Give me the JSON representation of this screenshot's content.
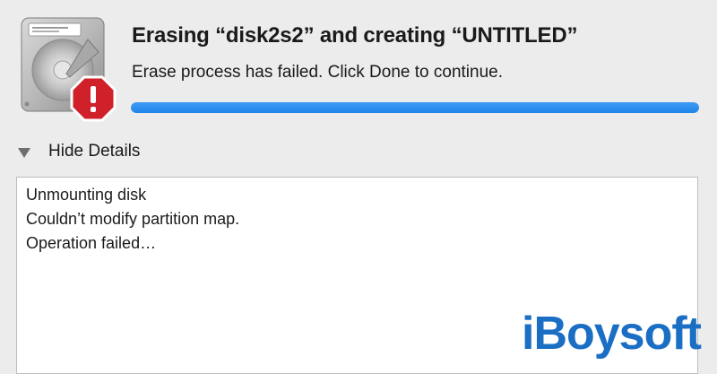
{
  "dialog": {
    "title": "Erasing “disk2s2” and creating “UNTITLED”",
    "subtitle": "Erase process has failed. Click Done to continue.",
    "progress_percent": 100,
    "accent_color": "#1f84ea",
    "icon": {
      "main": "hard-disk-icon",
      "badge": "warning-stop-icon",
      "badge_color": "#d0202a",
      "badge_symbol": "!"
    }
  },
  "details": {
    "toggle_label": "Hide Details",
    "log_lines": [
      "Unmounting disk",
      "Couldn’t modify partition map.",
      "Operation failed…"
    ]
  },
  "watermark": {
    "text": "iBoysoft",
    "color": "#1a6fc4"
  }
}
